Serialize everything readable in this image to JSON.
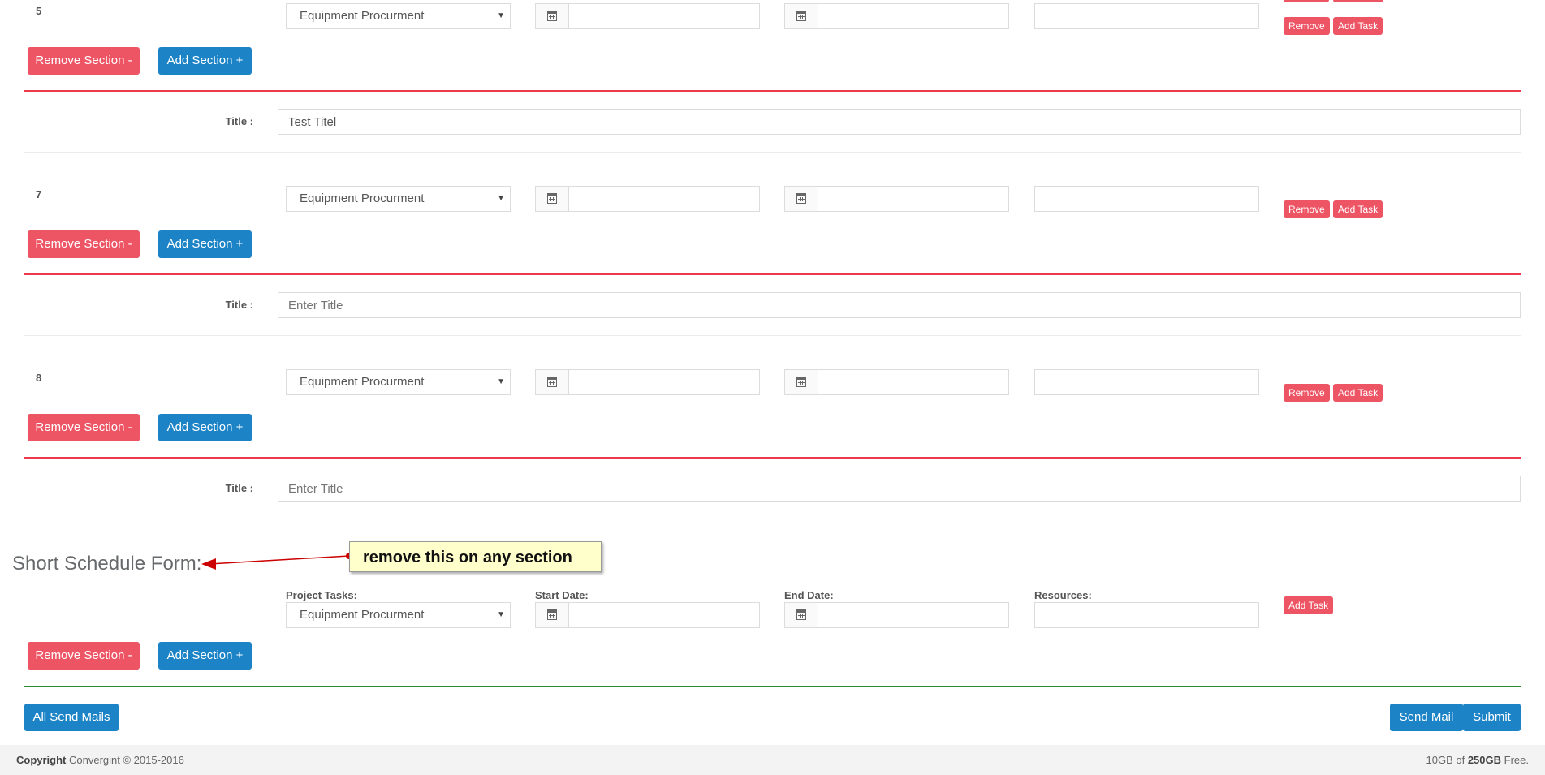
{
  "sections": [
    {
      "number": "5",
      "task_select": "Equipment Procurment",
      "remove_label": "Remove",
      "add_task_label": "Add Task",
      "remove_section_label": "Remove Section -",
      "add_section_label": "Add Section +",
      "title_label": "Title :",
      "title_value": "Test Titel",
      "title_placeholder": ""
    },
    {
      "number": "7",
      "task_select": "Equipment Procurment",
      "remove_label": "Remove",
      "add_task_label": "Add Task",
      "remove_section_label": "Remove Section -",
      "add_section_label": "Add Section +",
      "title_label": "Title :",
      "title_value": "",
      "title_placeholder": "Enter Title"
    },
    {
      "number": "8",
      "task_select": "Equipment Procurment",
      "remove_label": "Remove",
      "add_task_label": "Add Task",
      "remove_section_label": "Remove Section -",
      "add_section_label": "Add Section +",
      "title_label": "Title :",
      "title_value": "",
      "title_placeholder": "Enter Title"
    }
  ],
  "short_form": {
    "heading": "Short Schedule Form:",
    "project_tasks_label": "Project Tasks:",
    "start_date_label": "Start Date:",
    "end_date_label": "End Date:",
    "resources_label": "Resources:",
    "task_select": "Equipment Procurment",
    "add_task_label": "Add Task",
    "remove_section_label": "Remove Section -",
    "add_section_label": "Add Section +"
  },
  "annotation": {
    "text": "remove this on any section",
    "arrow_color": "#cc0000"
  },
  "actions": {
    "all_send_mails": "All Send Mails",
    "send_mail": "Send Mail",
    "submit": "Submit"
  },
  "footer": {
    "copyright_bold": "Copyright",
    "copyright_text": "Convergint © 2015-2016",
    "storage_used": "10GB of",
    "storage_total": "250GB",
    "storage_suffix": "Free."
  },
  "colors": {
    "danger": "#ed5565",
    "primary": "#1c84c6",
    "divider_red": "#ed3a4a",
    "divider_green": "#2d8a34"
  },
  "icons": {
    "date_addon": "calendar-icon",
    "select_caret": "caret-down-icon"
  }
}
